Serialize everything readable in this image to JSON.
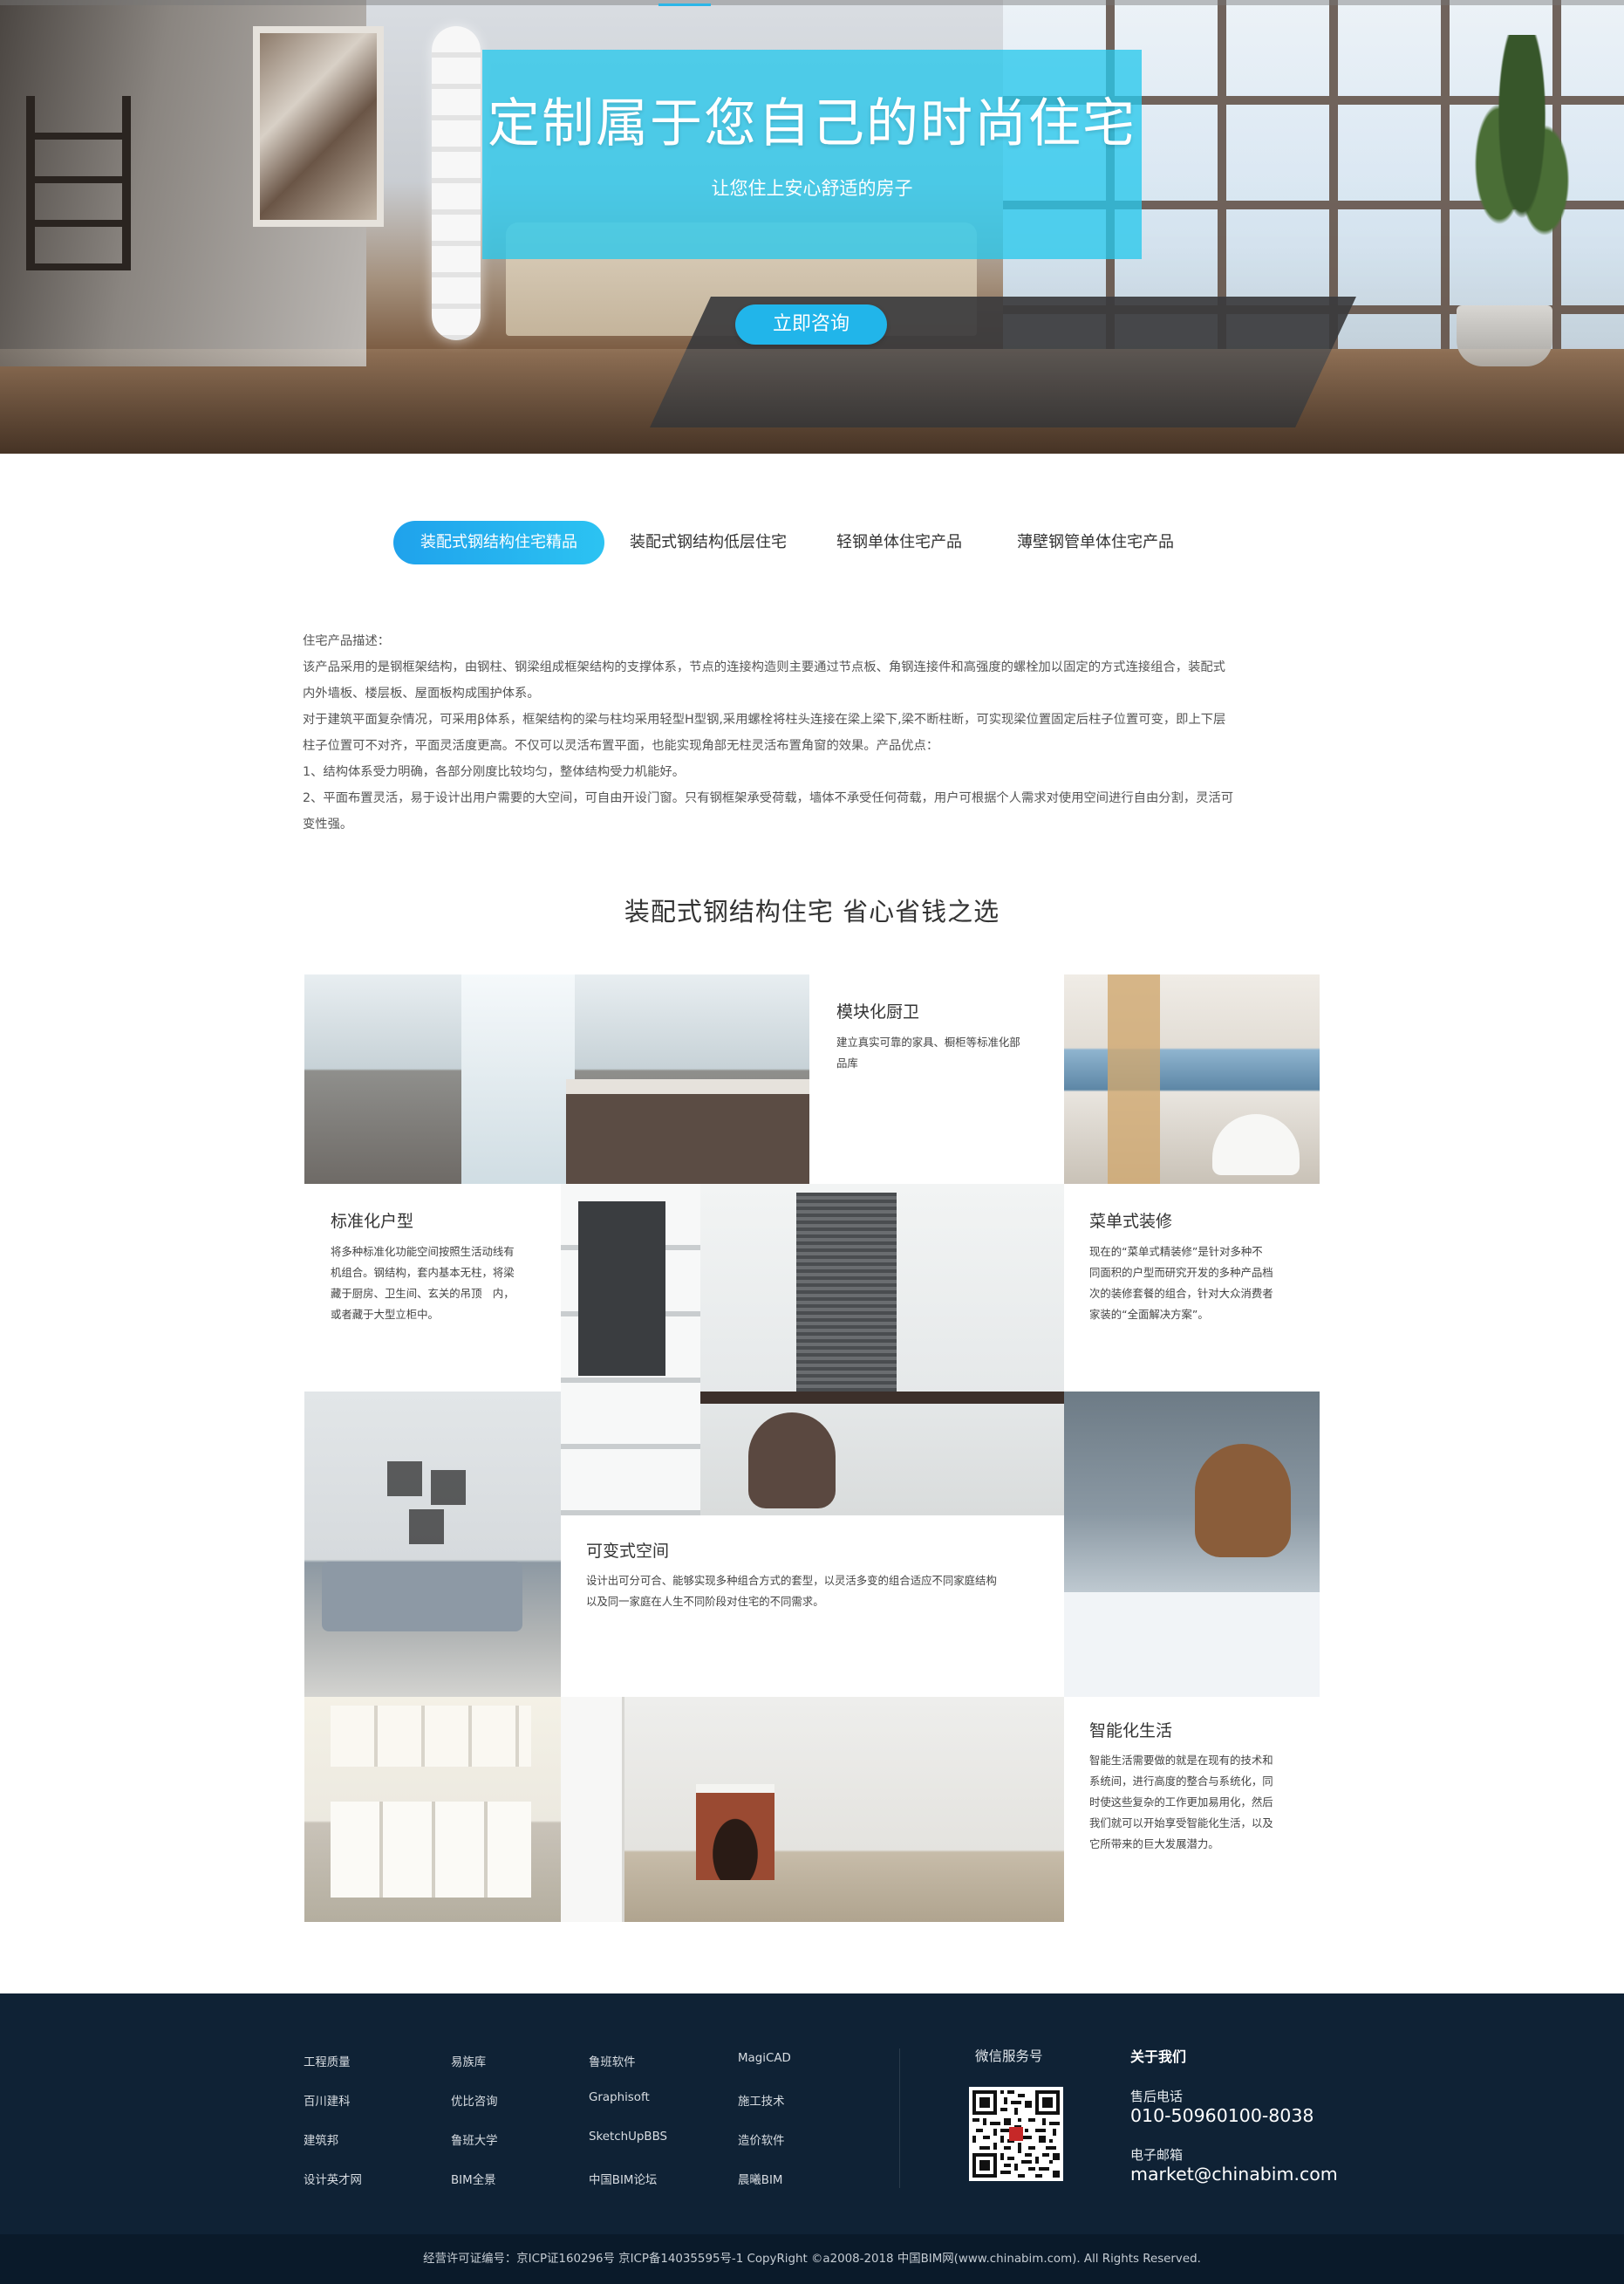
{
  "hero": {
    "title": "定制属于您自己的时尚住宅",
    "subtitle": "让您住上安心舒适的房子",
    "cta_label": "立即咨询"
  },
  "tabs": [
    {
      "label": "装配式钢结构住宅精品",
      "active": true
    },
    {
      "label": "装配式钢结构低层住宅",
      "active": false
    },
    {
      "label": "轻钢单体住宅产品",
      "active": false
    },
    {
      "label": "薄壁钢管单体住宅产品",
      "active": false
    }
  ],
  "description": {
    "lines": [
      "住宅产品描述：",
      "该产品采用的是钢框架结构，由钢柱、钢梁组成框架结构的支撑体系，节点的连接构造则主要通过节点板、角钢连接件和高强度的螺栓加以固定的方式连接组合，装配式",
      "内外墙板、楼层板、屋面板构成围护体系。",
      "对于建筑平面复杂情况，可采用β体系，框架结构的梁与柱均采用轻型H型钢,采用螺栓将柱头连接在梁上梁下,梁不断柱断，可实现梁位置固定后柱子位置可变，即上下层",
      "柱子位置可不对齐，平面灵活度更高。不仅可以灵活布置平面，也能实现角部无柱灵活布置角窗的效果。产品优点：",
      "1、结构体系受力明确，各部分刚度比较均匀，整体结构受力机能好。",
      "2、平面布置灵活，易于设计出用户需要的大空间，可自由开设门窗。只有钢框架承受荷载，墙体不承受任何荷载，用户可根据个人需求对使用空间进行自由分割，灵活可",
      "变性强。"
    ]
  },
  "section": {
    "title": "装配式钢结构住宅  省心省钱之选"
  },
  "features": {
    "modular_kitchen": {
      "title": "模块化厨卫",
      "lines": [
        "建立真实可靠的家具、橱柜等标准化部",
        "品库"
      ]
    },
    "standard_layout": {
      "title": "标准化户型",
      "lines": [
        "将多种标准化功能空间按照生活动线有",
        "机组合。钢结构，套内基本无柱，将梁",
        "藏于厨房、卫生间、玄关的吊顶　内，",
        "或者藏于大型立柜中。"
      ]
    },
    "menu_decoration": {
      "title": "菜单式装修",
      "lines": [
        "现在的“菜单式精装修”是针对多种不",
        "同面积的户型而研究开发的多种产品档",
        "次的装修套餐的组合，针对大众消费者",
        "家装的“全面解决方案”。"
      ]
    },
    "flexible_space": {
      "title": "可变式空间",
      "lines": [
        "设计出可分可合、能够实现多种组合方式的套型，以灵活多变的组合适应不同家庭结构",
        "以及同一家庭在人生不同阶段对住宅的不同需求。"
      ]
    },
    "smart_living": {
      "title": "智能化生活",
      "lines": [
        "智能生活需要做的就是在现有的技术和",
        "系统间，进行高度的整合与系统化，同",
        "时使这些复杂的工作更加易用化，然后",
        "我们就可以开始享受智能化生活，以及",
        "它所带来的巨大发展潜力。"
      ]
    }
  },
  "footer": {
    "links": [
      [
        "工程质量",
        "易族库",
        "鲁班软件",
        "MagiCAD"
      ],
      [
        "百川建科",
        "优比咨询",
        "Graphisoft",
        "施工技术"
      ],
      [
        "建筑邦",
        "鲁班大学",
        "SketchUpBBS",
        "造价软件"
      ],
      [
        "设计英才网",
        "BIM全景",
        "中国BIM论坛",
        "晨曦BIM"
      ]
    ],
    "wechat_label": "微信服务号",
    "about_title": "关于我们",
    "phone_label": "售后电话",
    "phone_value": "010-50960100-8038",
    "email_label": "电子邮箱",
    "email_value": "market@chinabim.com",
    "copyright": "经营许可证编号：京ICP证160296号 京ICP备14035595号-1 CopyRight ©a2008-2018 中国BIM网(www.chinabim.com). All Rights Reserved."
  },
  "colors": {
    "accent": "#21b5ea",
    "banner_overlay": "#28c8ec",
    "footer_bg": "#0f2235",
    "copyright_bg": "#0a1a2a"
  }
}
